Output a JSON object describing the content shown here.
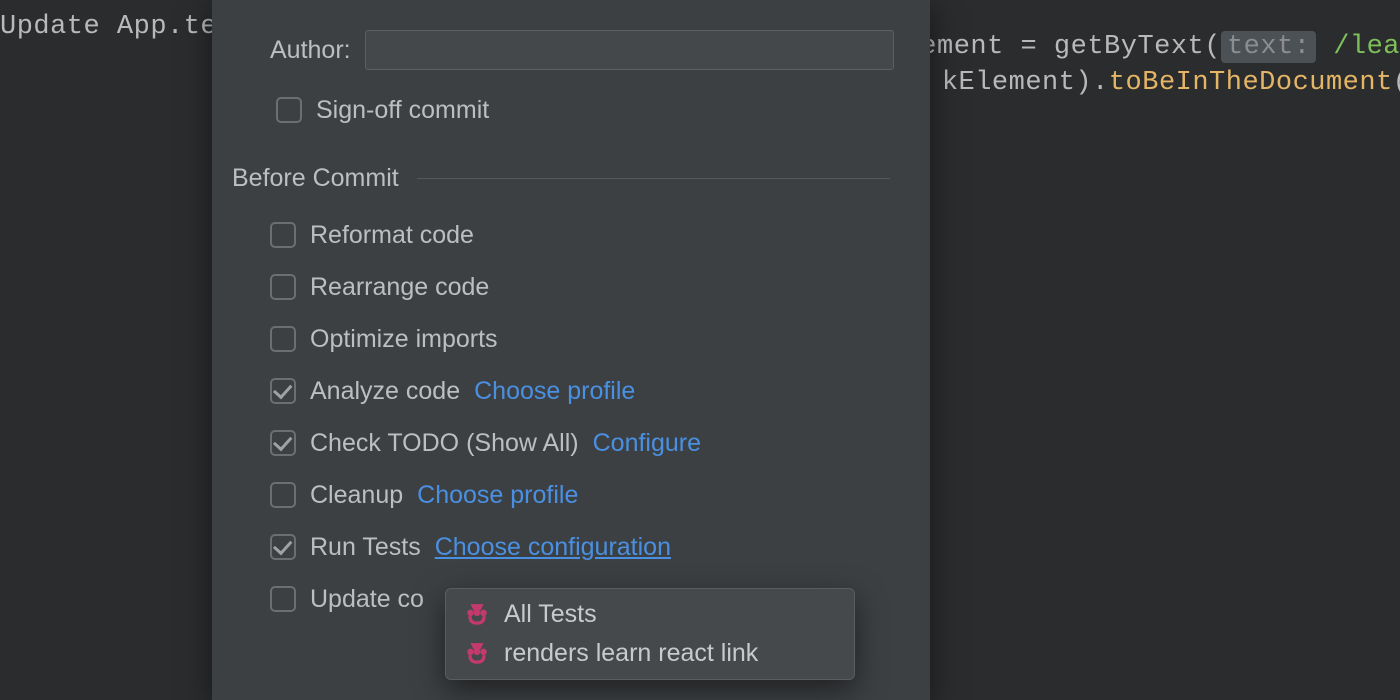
{
  "editor": {
    "tab_title": "Update App.te",
    "code_right_1": "Element = getByText(",
    "code_pill": "text:",
    "code_regex": "/lea",
    "code_line2_a": "kElement).",
    "code_line2_b": "toBeInTheDocument",
    "code_line2_c": "()"
  },
  "panel": {
    "author_label": "Author:",
    "author_value": "",
    "sign_off_label": "Sign-off commit",
    "section_title": "Before Commit",
    "checks": {
      "reformat": {
        "label": "Reformat code",
        "checked": false
      },
      "rearrange": {
        "label": "Rearrange code",
        "checked": false
      },
      "optimize": {
        "label": "Optimize imports",
        "checked": false
      },
      "analyze": {
        "label": "Analyze code",
        "checked": true,
        "link": "Choose profile"
      },
      "todo": {
        "label": "Check TODO (Show All)",
        "checked": true,
        "link": "Configure"
      },
      "cleanup": {
        "label": "Cleanup",
        "checked": false,
        "link": "Choose profile"
      },
      "runtests": {
        "label": "Run Tests",
        "checked": true,
        "link": "Choose configuration"
      },
      "update": {
        "label": "Update co",
        "checked": false
      }
    }
  },
  "popup": {
    "items": [
      {
        "label": "All Tests"
      },
      {
        "label": "renders learn react link"
      }
    ]
  },
  "colors": {
    "link": "#4a90e2",
    "jest": "#c33a6b"
  }
}
